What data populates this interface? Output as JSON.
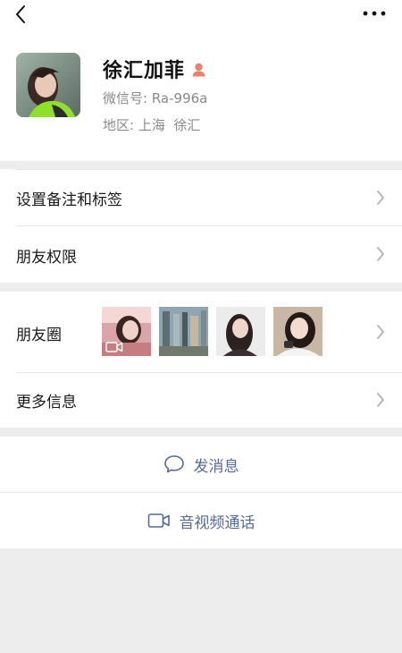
{
  "profile": {
    "name": "徐汇加菲",
    "wechat_id": "微信号: Ra-996a",
    "region": "地区: 上海  徐汇"
  },
  "rows": {
    "remark": "设置备注和标签",
    "permissions": "朋友权限",
    "moments": "朋友圈",
    "more_info": "更多信息"
  },
  "actions": {
    "message": "发消息",
    "call": "音视频通话"
  },
  "colors": {
    "link": "#576b95",
    "gender_female": "#e8826a",
    "page_bg": "#ededed",
    "secondary_text": "#8a8a8a"
  },
  "icons": [
    "back-icon",
    "more-icon",
    "female-icon",
    "chevron-right-icon",
    "chat-bubble-icon",
    "video-camera-icon",
    "video-badge-icon"
  ]
}
